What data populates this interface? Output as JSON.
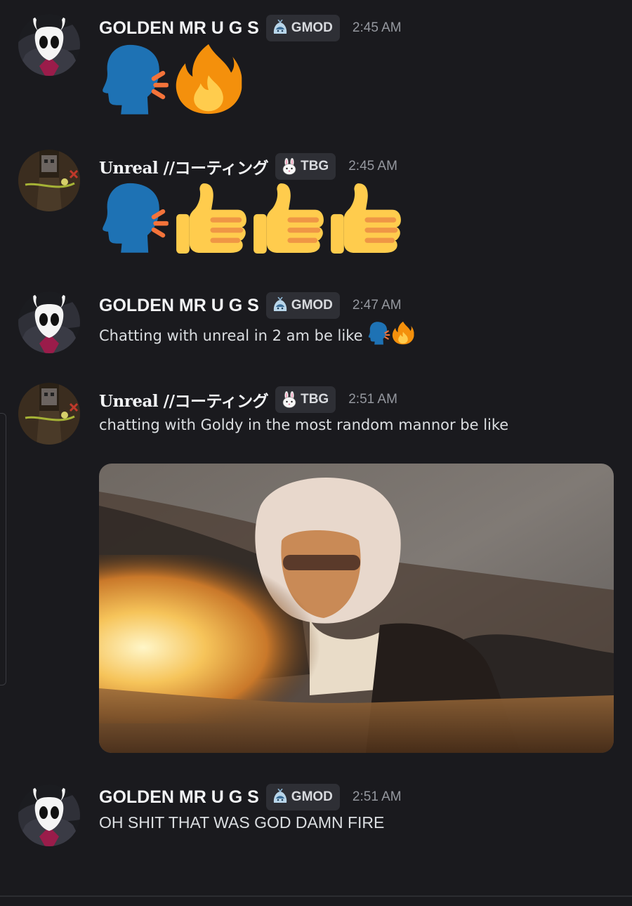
{
  "messages": [
    {
      "username": "GOLDEN MR U G S",
      "tag": "GMOD",
      "time": "2:45 AM",
      "emojis": [
        "speaking-head",
        "fire"
      ]
    },
    {
      "username": "Unreal //コーティング",
      "tag": "TBG",
      "time": "2:45 AM",
      "emojis": [
        "speaking-head",
        "thumbs-up",
        "thumbs-up",
        "thumbs-up"
      ]
    },
    {
      "username": "GOLDEN MR U G S",
      "tag": "GMOD",
      "time": "2:47 AM",
      "text": "Chatting with unreal in 2 am be like",
      "emojis": [
        "speaking-head",
        "fire"
      ]
    },
    {
      "username": "Unreal //コーティング",
      "tag": "TBG",
      "time": "2:51 AM",
      "text": "chatting with Goldy in the most random mannor be like",
      "attachment": "gif-image"
    },
    {
      "username": "GOLDEN MR U G S",
      "tag": "GMOD",
      "time": "2:51 AM",
      "text": "OH SHIT THAT WAS GOD DAMN FIRE"
    }
  ],
  "colors": {
    "background": "#1a1a1e",
    "username": "#f2f3f5",
    "timestamp": "#95989f",
    "tag_bg": "#2e2f35"
  }
}
